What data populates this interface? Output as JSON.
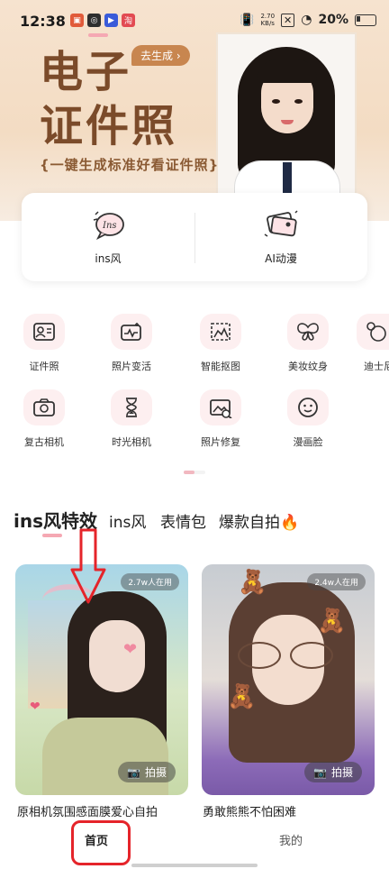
{
  "status_bar": {
    "time": "12:38",
    "net_speed_value": "2.70",
    "net_speed_unit": "KB/s",
    "battery": "20%"
  },
  "banner": {
    "title_line1": "电子",
    "title_line2": "证件照",
    "generate_button": "去生成 ›",
    "subtitle": "{一键生成标准好看证件照}"
  },
  "quick_actions": [
    {
      "label": "ins风",
      "icon": "ins-speech-bubble-icon"
    },
    {
      "label": "AI动漫",
      "icon": "ai-anime-photos-icon"
    }
  ],
  "tools_row1": [
    {
      "label": "证件照",
      "icon": "id-card-icon"
    },
    {
      "label": "照片变活",
      "icon": "photo-animate-icon"
    },
    {
      "label": "智能抠图",
      "icon": "smart-cutout-icon"
    },
    {
      "label": "美妆纹身",
      "icon": "butterfly-icon"
    },
    {
      "label": "迪士尼",
      "icon": "mickey-icon"
    }
  ],
  "tools_row2": [
    {
      "label": "复古相机",
      "icon": "retro-camera-icon"
    },
    {
      "label": "时光相机",
      "icon": "hourglass-icon"
    },
    {
      "label": "照片修复",
      "icon": "photo-repair-icon"
    },
    {
      "label": "漫画脸",
      "icon": "cartoon-face-icon"
    }
  ],
  "tabs": [
    {
      "label": "ins风特效",
      "active": true
    },
    {
      "label": "ins风",
      "active": false
    },
    {
      "label": "表情包",
      "active": false
    },
    {
      "label": "爆款自拍🔥",
      "active": false
    }
  ],
  "cards": [
    {
      "title": "原相机氛围感面膜爱心自拍",
      "users": "2.7w人在用",
      "shoot_label": "拍摄"
    },
    {
      "title": "勇敢熊熊不怕困难",
      "users": "2.4w人在用",
      "shoot_label": "拍摄"
    }
  ],
  "bottom_nav": [
    {
      "label": "首页",
      "active": true
    },
    {
      "label": "我的",
      "active": false
    }
  ],
  "colors": {
    "accent_pink": "#f5a8b3",
    "banner_brown": "#7b4b2a",
    "annotation_red": "#e5242a"
  }
}
